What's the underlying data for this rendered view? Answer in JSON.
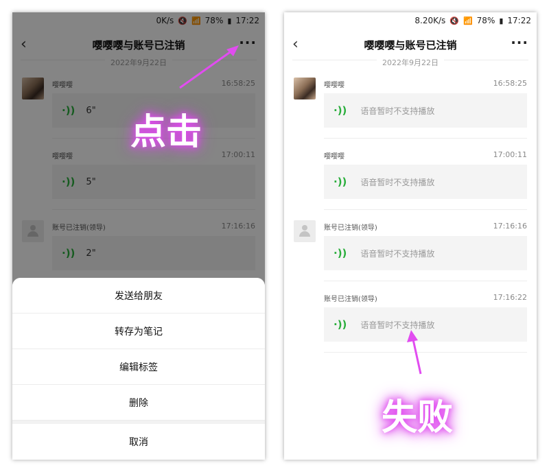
{
  "left": {
    "status": {
      "speed": "0K/s",
      "battery": "78%",
      "time": "17:22"
    },
    "title": "嘤嘤嘤与账号已注销",
    "date": "2022年9月22日",
    "messages": [
      {
        "sender": "嘤嘤嘤",
        "time": "16:58:25",
        "duration": "6\"",
        "avatar": "photo"
      },
      {
        "sender": "嘤嘤嘤",
        "time": "17:00:11",
        "duration": "5\"",
        "avatar": "none"
      },
      {
        "sender": "账号已注销(领导)",
        "time": "17:16:16",
        "duration": "2\"",
        "avatar": "default"
      }
    ],
    "sheet": {
      "options": [
        "发送给朋友",
        "转存为笔记",
        "编辑标签",
        "删除"
      ],
      "cancel": "取消"
    }
  },
  "right": {
    "status": {
      "speed": "8.20K/s",
      "battery": "78%",
      "time": "17:22"
    },
    "title": "嘤嘤嘤与账号已注销",
    "date": "2022年9月22日",
    "messages": [
      {
        "sender": "嘤嘤嘤",
        "time": "16:58:25",
        "text": "语音暂时不支持播放",
        "avatar": "photo"
      },
      {
        "sender": "嘤嘤嘤",
        "time": "17:00:11",
        "text": "语音暂时不支持播放",
        "avatar": "none"
      },
      {
        "sender": "账号已注销(领导)",
        "time": "17:16:16",
        "text": "语音暂时不支持播放",
        "avatar": "default"
      },
      {
        "sender": "账号已注销(领导)",
        "time": "17:16:22",
        "text": "语音暂时不支持播放",
        "avatar": "none"
      }
    ]
  },
  "annotations": {
    "click": "点击",
    "fail": "失败",
    "color": "#e14cf0"
  },
  "icons": {
    "back": "chevron-left-icon",
    "more": "more-dots-icon",
    "voice": "voice-wave-icon"
  }
}
